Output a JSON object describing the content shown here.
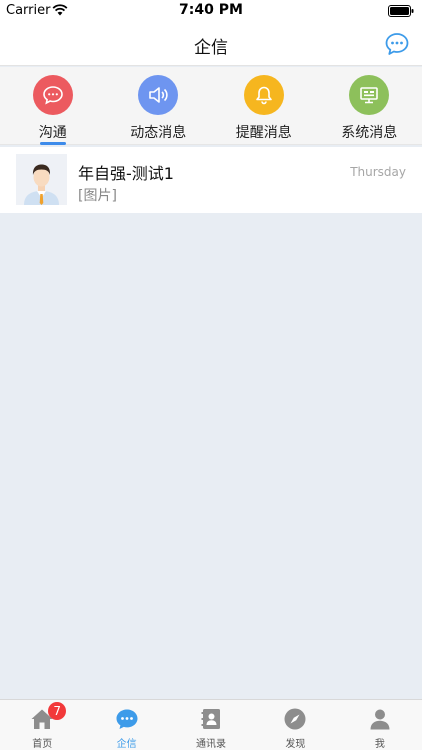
{
  "status_bar": {
    "carrier": "Carrier",
    "time": "7:40 PM"
  },
  "nav": {
    "title": "企信"
  },
  "categories": [
    {
      "label": "沟通",
      "color": "#ec5a5f",
      "icon": "chat-bubble-icon",
      "active": true
    },
    {
      "label": "动态消息",
      "color": "#6e95f0",
      "icon": "speaker-icon",
      "active": false
    },
    {
      "label": "提醒消息",
      "color": "#f6b61f",
      "icon": "bell-icon",
      "active": false
    },
    {
      "label": "系统消息",
      "color": "#8dc05b",
      "icon": "monitor-icon",
      "active": false
    }
  ],
  "messages": [
    {
      "name": "年自强-测试1",
      "preview": "[图片]",
      "time": "Thursday",
      "avatar": "person-avatar-icon"
    }
  ],
  "tabs": [
    {
      "label": "首页",
      "icon": "home-icon",
      "badge": "7",
      "active": false
    },
    {
      "label": "企信",
      "icon": "chat-icon",
      "badge": "",
      "active": true
    },
    {
      "label": "通讯录",
      "icon": "contacts-icon",
      "badge": "",
      "active": false
    },
    {
      "label": "发现",
      "icon": "compass-icon",
      "badge": "",
      "active": false
    },
    {
      "label": "我",
      "icon": "profile-icon",
      "badge": "",
      "active": false
    }
  ],
  "colors": {
    "accent": "#3d9be9",
    "background": "#e8edf3",
    "badge": "#f2393a"
  }
}
